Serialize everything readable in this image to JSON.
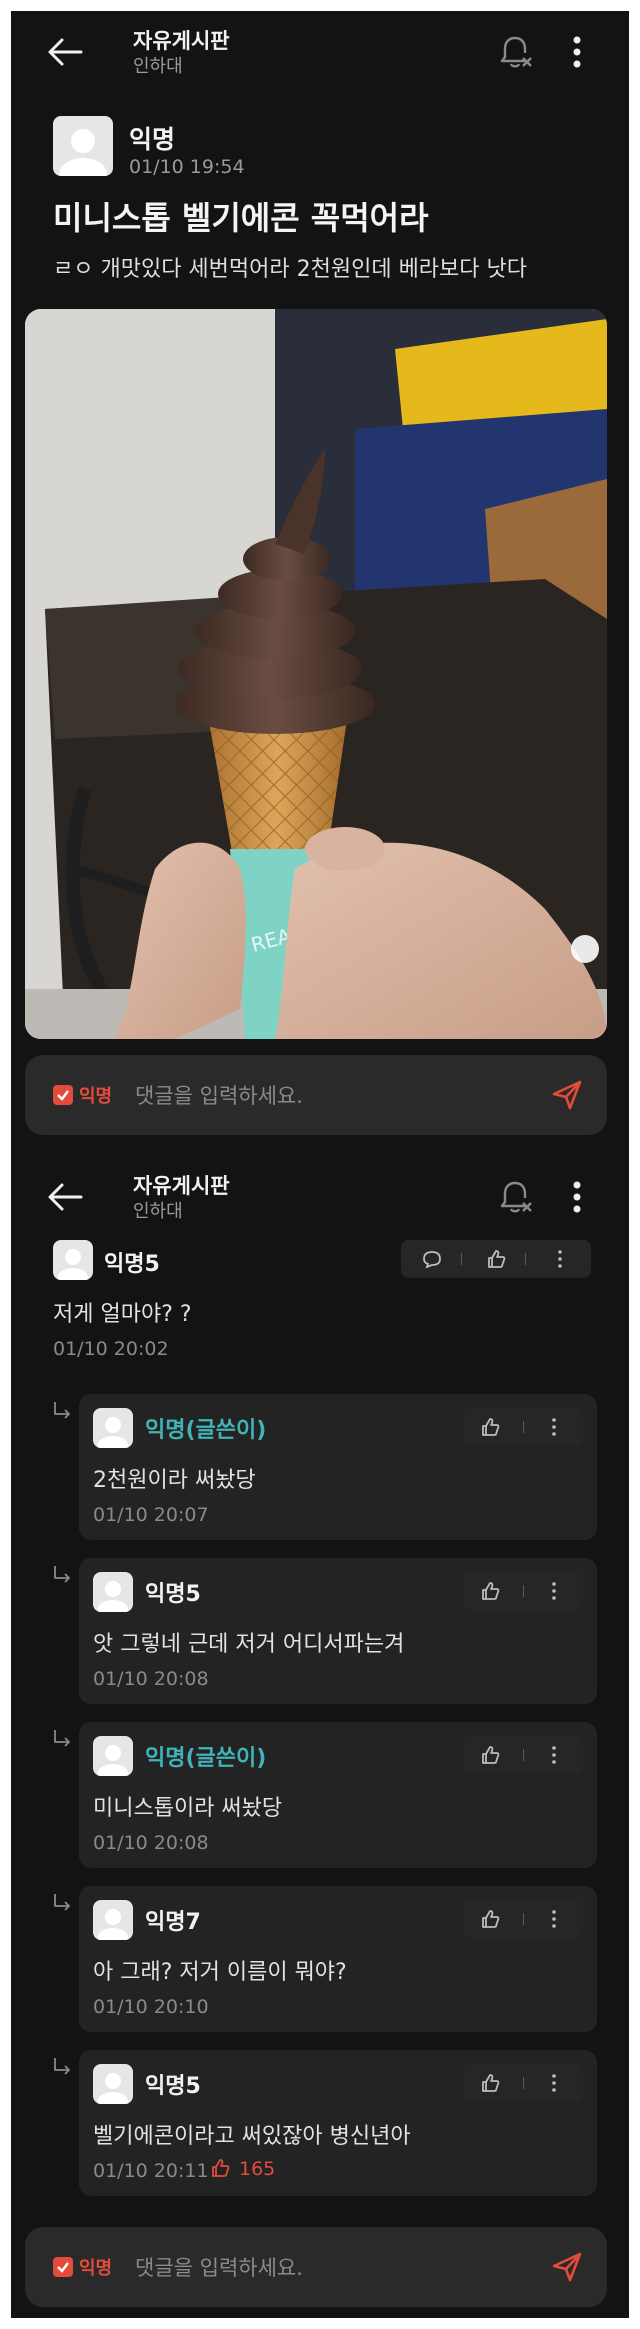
{
  "header": {
    "board": "자유게시판",
    "school": "인하대"
  },
  "post": {
    "author": "익명",
    "time": "01/10 19:54",
    "title": "미니스톱 벨기에콘 꼭먹어라",
    "body": "ㄹㅇ 개맛있다 세번먹어라 2천원인데 베라보다 낫다",
    "image_alt": "chocolate soft-serve ice cream cone held in hand"
  },
  "comment_bar": {
    "anon_label": "익명",
    "placeholder": "댓글을 입력하세요."
  },
  "comments": [
    {
      "author": "익명5",
      "text": "저게 얼마야? ?",
      "time": "01/10 20:02"
    }
  ],
  "replies": [
    {
      "author": "익명(글쓴이)",
      "text": "2천원이라 써놨당",
      "time": "01/10 20:07",
      "is_op": true
    },
    {
      "author": "익명5",
      "text": "앗 그렇네 근데 저거 어디서파는겨",
      "time": "01/10 20:08",
      "is_op": false
    },
    {
      "author": "익명(글쓴이)",
      "text": "미니스톱이라 써놨당",
      "time": "01/10 20:08",
      "is_op": true
    },
    {
      "author": "익명7",
      "text": "아 그래? 저거 이름이 뭐야?",
      "time": "01/10 20:10",
      "is_op": false
    },
    {
      "author": "익명5",
      "text": "벨기에콘이라고 써있잖아 병신년아",
      "time": "01/10 20:11",
      "is_op": false,
      "likes": "165"
    }
  ],
  "colors": {
    "background": "#131313",
    "accent_red": "#e34b3b",
    "op_teal": "#3fb3b5",
    "card": "#232323"
  },
  "icons": [
    "back-arrow-icon",
    "notification-off-icon",
    "more-vertical-icon",
    "comment-icon",
    "thumbs-up-icon",
    "send-icon",
    "reply-arrow-icon",
    "checkbox-icon"
  ]
}
